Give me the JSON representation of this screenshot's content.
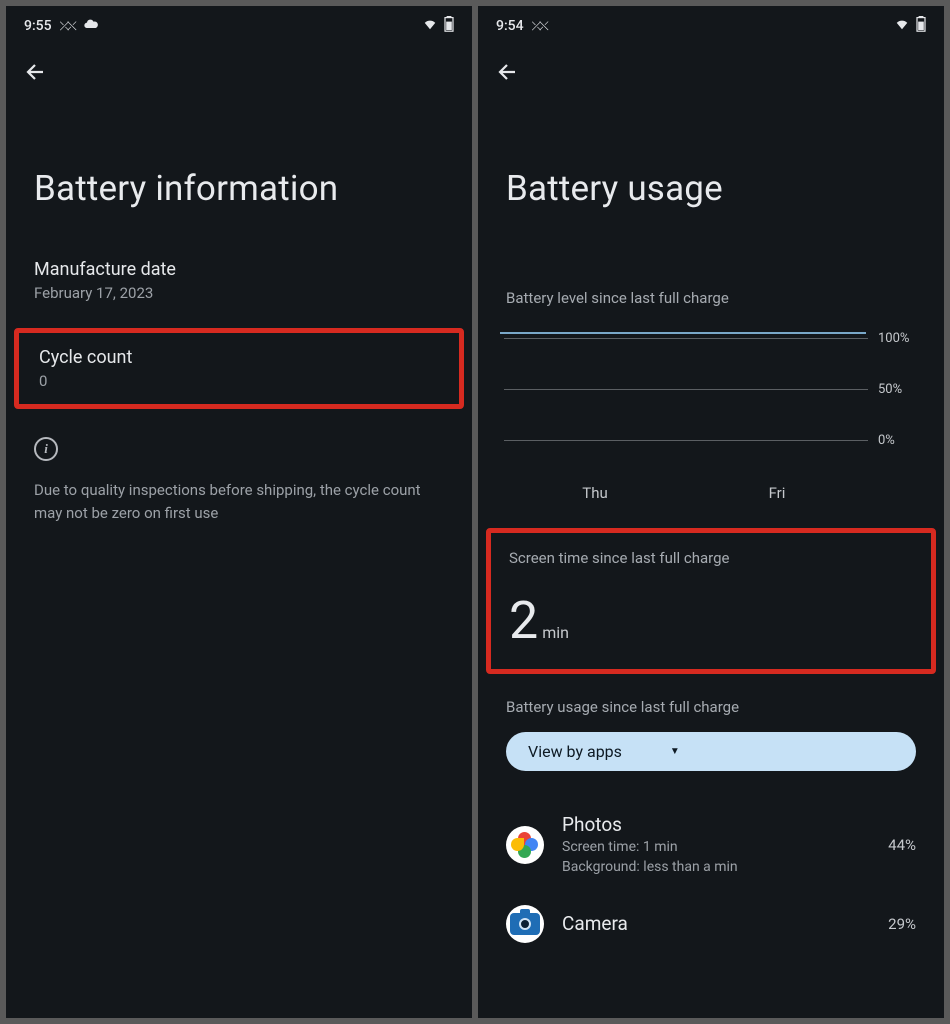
{
  "left": {
    "status": {
      "time": "9:55"
    },
    "title": "Battery information",
    "manufacture": {
      "label": "Manufacture date",
      "value": "February 17, 2023"
    },
    "cycle": {
      "label": "Cycle count",
      "value": "0"
    },
    "note": "Due to quality inspections before shipping, the cycle count may not be zero on first use"
  },
  "right": {
    "status": {
      "time": "9:54"
    },
    "title": "Battery usage",
    "chart_label": "Battery level since last full charge",
    "screen_time": {
      "label": "Screen time since last full charge",
      "value": "2",
      "unit": "min"
    },
    "usage_label": "Battery usage since last full charge",
    "chip": "View by apps",
    "apps": [
      {
        "name": "Photos",
        "line1": "Screen time: 1 min",
        "line2": "Background: less than a min",
        "pct": "44%"
      },
      {
        "name": "Camera",
        "line1": "",
        "line2": "",
        "pct": "29%"
      }
    ]
  },
  "chart_data": {
    "type": "line",
    "title": "Battery level since last full charge",
    "ylabel": "",
    "xlabel": "",
    "yticks": [
      "100%",
      "50%",
      "0%"
    ],
    "ylim": [
      0,
      100
    ],
    "categories": [
      "Thu",
      "Fri"
    ],
    "values": [
      100,
      100
    ]
  }
}
